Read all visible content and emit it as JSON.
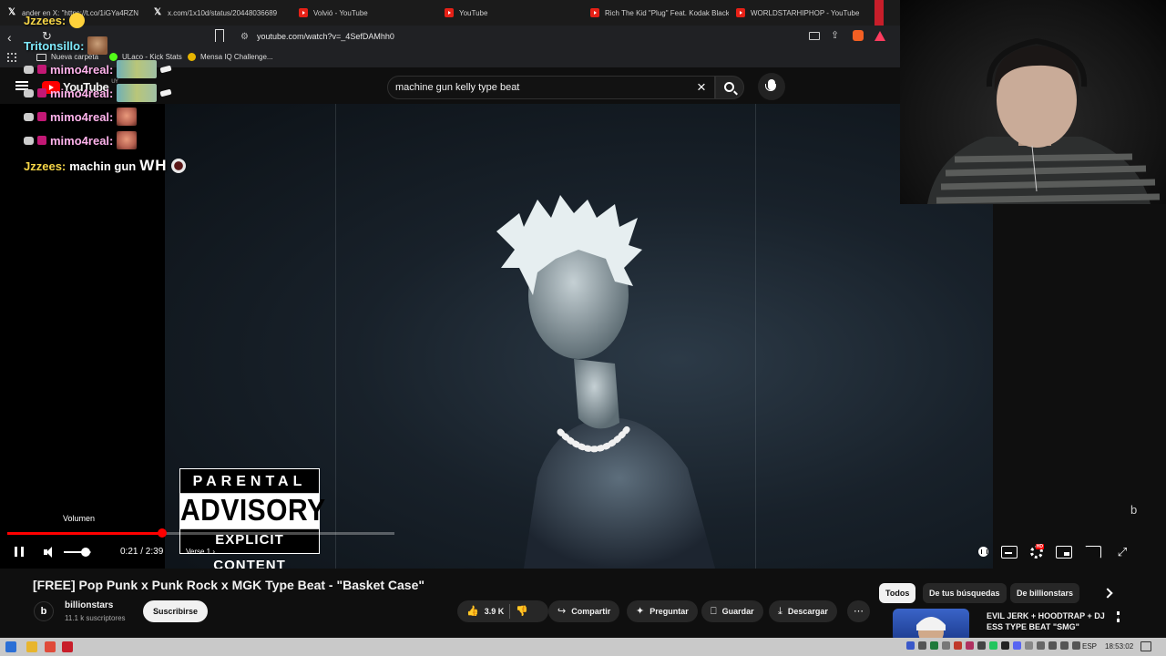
{
  "browser": {
    "tabs": [
      {
        "label": "ander en X: \"https://t.co/1iGYa4RZN",
        "icon": "x-icon"
      },
      {
        "label": "x.com/1x10d/status/20448036689",
        "icon": "x-icon"
      },
      {
        "label": "Volvió - YouTube",
        "icon": "youtube-icon"
      },
      {
        "label": "YouTube",
        "icon": "youtube-icon"
      },
      {
        "label": "Rich The Kid \"Plug\" Feat. Kodak Black",
        "icon": "youtube-icon"
      },
      {
        "label": "WORLDSTARHIPHOP - YouTube",
        "icon": "youtube-icon"
      }
    ],
    "url": "youtube.com/watch?v=_4SefDAMhh0",
    "bookmarks": [
      {
        "label": "Nueva carpeta",
        "icon": "folder-icon"
      },
      {
        "label": "ULaco - Kick Stats",
        "icon": "kick-icon"
      },
      {
        "label": "Mensa IQ Challenge...",
        "icon": "mensa-icon"
      }
    ]
  },
  "youtube": {
    "logo": "YouTube",
    "region": "UY",
    "search": {
      "value": "machine gun kelly type beat"
    }
  },
  "player": {
    "parental_advisory": {
      "top": "PARENTAL",
      "mid": "ADVISORY",
      "bottom": "EXPLICIT CONTENT"
    },
    "volume_tooltip": "Volumen",
    "time": "0:21 / 2:39",
    "chapter": "Verse 1",
    "progress_percent": 40,
    "volume_percent": 80,
    "watermark": "b"
  },
  "chat": [
    {
      "user": "Jzzees:",
      "color": "#f5d547",
      "emote": "smile"
    },
    {
      "user": "Tritonsillo:",
      "color": "#7ee8fa",
      "emote": "dog"
    },
    {
      "user": "mimo4real:",
      "color": "#ffb3ec",
      "emote": "people"
    },
    {
      "user": "mimo4real:",
      "color": "#ffb3ec",
      "emote": "people"
    },
    {
      "user": "mimo4real:",
      "color": "#ffb3ec",
      "emote": "face"
    },
    {
      "user": "mimo4real:",
      "color": "#ffb3ec",
      "emote": "face"
    },
    {
      "user": "Jzzees:",
      "color": "#f5d547",
      "message": "machin gun",
      "big": "WH"
    }
  ],
  "video": {
    "title": "[FREE] Pop Punk x Punk Rock x MGK Type Beat - \"Basket Case\"",
    "channel": "billionstars",
    "channel_avatar": "b",
    "subscribers": "11.1 k suscriptores",
    "subscribe": "Suscribirse",
    "likes": "3.9 K",
    "share": "Compartir",
    "ask": "Preguntar",
    "save": "Guardar",
    "download": "Descargar"
  },
  "filters": [
    "Todos",
    "De tus búsquedas",
    "De billionstars"
  ],
  "recommendation": {
    "title": "EVIL JERK + HOODTRAP + DJ ESS TYPE BEAT \"SMG\""
  },
  "taskbar": {
    "lang": "ESP",
    "clock": "18:53:02"
  },
  "colors": {
    "accent": "#ff0000",
    "background": "#0f0f0f"
  }
}
